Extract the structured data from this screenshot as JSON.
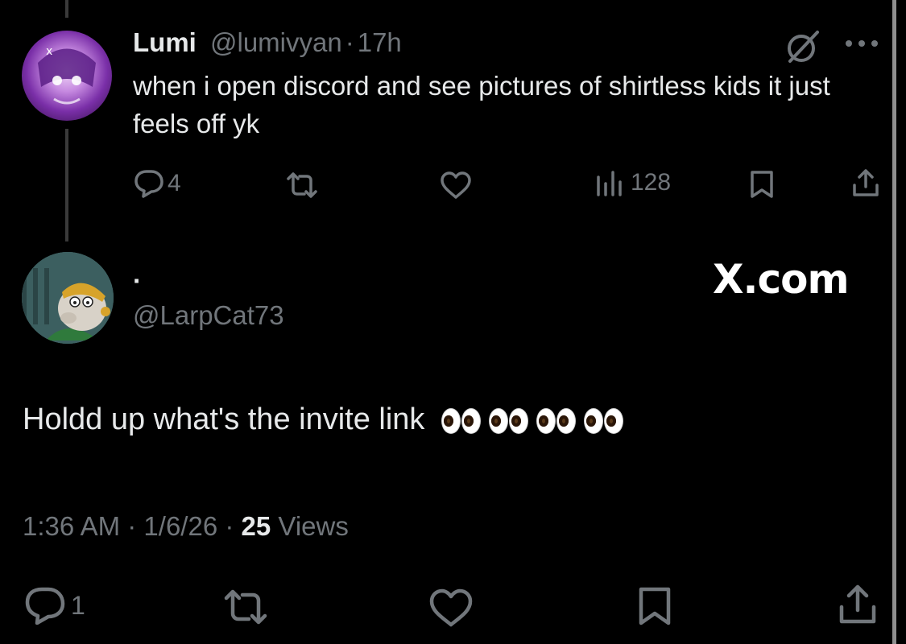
{
  "parent_tweet": {
    "display_name": "Lumi",
    "handle": "@lumivyan",
    "separator": "·",
    "age": "17h",
    "text": "when i open discord and see pictures of shirtless kids it just feels off yk",
    "reply_count": "4",
    "views": "128"
  },
  "reply_tweet": {
    "display_name": "·",
    "handle": "@LarpCat73",
    "text": "Holdd up what's the invite link",
    "eyes_emoji_count": 4,
    "time": "1:36 AM",
    "date": "1/6/26",
    "views_count": "25",
    "views_label": "Views",
    "reply_count": "1"
  },
  "watermark": "X.com",
  "colors": {
    "background": "#000000",
    "text": "#e7e9ea",
    "muted": "#71767b",
    "avatar1": "#9b4dca",
    "avatar2": "#5b7b7a"
  }
}
